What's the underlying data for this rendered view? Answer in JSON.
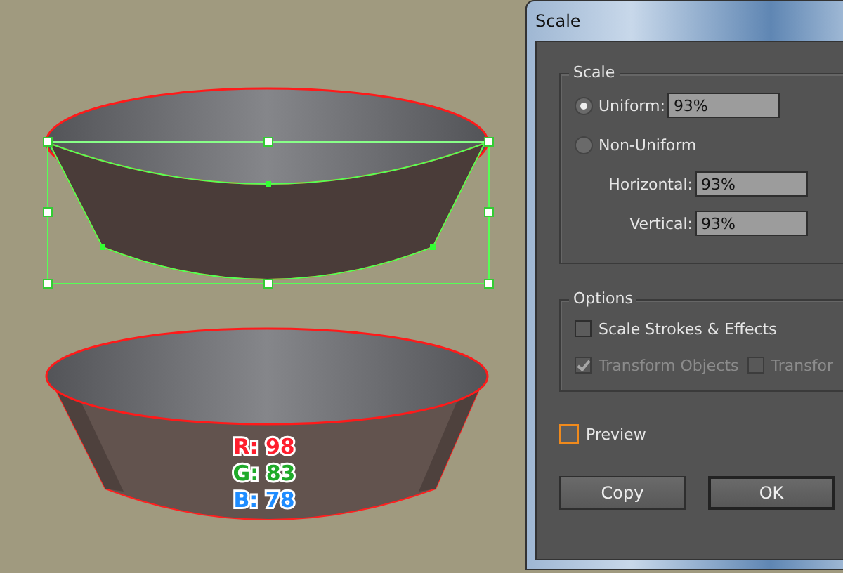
{
  "canvas": {
    "color_labels": [
      {
        "text": "R: 98",
        "color": "#ff1e2d"
      },
      {
        "text": "G: 83",
        "color": "#1faa2a"
      },
      {
        "text": "B: 78",
        "color": "#1e8cff"
      }
    ]
  },
  "dialog": {
    "title": "Scale",
    "scale_group": {
      "legend": "Scale",
      "modes": [
        {
          "label": "Uniform:",
          "selected": true,
          "value": "93%"
        },
        {
          "label": "Non-Uniform",
          "selected": false
        }
      ],
      "fields": [
        {
          "label": "Horizontal:",
          "value": "93%"
        },
        {
          "label": "Vertical:",
          "value": "93%"
        }
      ]
    },
    "options_group": {
      "legend": "Options",
      "rows": [
        [
          {
            "label": "Scale Strokes & Effects",
            "checked": false,
            "disabled": false
          }
        ],
        [
          {
            "label": "Transform Objects",
            "checked": true,
            "disabled": true
          },
          {
            "label": "Transfor",
            "checked": false,
            "disabled": true
          }
        ]
      ]
    },
    "preview": {
      "label": "Preview",
      "checked": false
    },
    "buttons": [
      {
        "label": "Copy",
        "default": false
      },
      {
        "label": "OK",
        "default": true
      }
    ]
  }
}
